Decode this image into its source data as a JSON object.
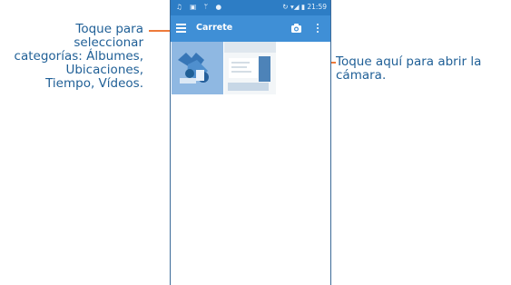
{
  "callouts": {
    "left_lines": [
      "Toque para",
      "seleccionar",
      "categorías: Álbumes,",
      "Ubicaciones,",
      "Tiempo, Vídeos."
    ],
    "right_lines": [
      "Toque aquí para abrir la",
      "cámara."
    ]
  },
  "status_bar": {
    "left_icons": "♫ ▣ ᛘ ●",
    "right": "↻ ▾◢ ▮ 21:59"
  },
  "app_bar": {
    "title": "Carrete",
    "menu_icon": "hamburger-menu-icon",
    "camera_icon": "camera-icon",
    "more_icon": "more-vertical-icon"
  },
  "colors": {
    "callout_text": "#1f5f96",
    "leader_line": "#ee7a3a",
    "status_bar": "#2d7dc5",
    "app_bar": "#3f8fd6",
    "phone_border": "#3b6a98"
  },
  "gallery": {
    "items": [
      {
        "name": "photo-thumbnail-1"
      },
      {
        "name": "photo-thumbnail-2"
      }
    ]
  }
}
